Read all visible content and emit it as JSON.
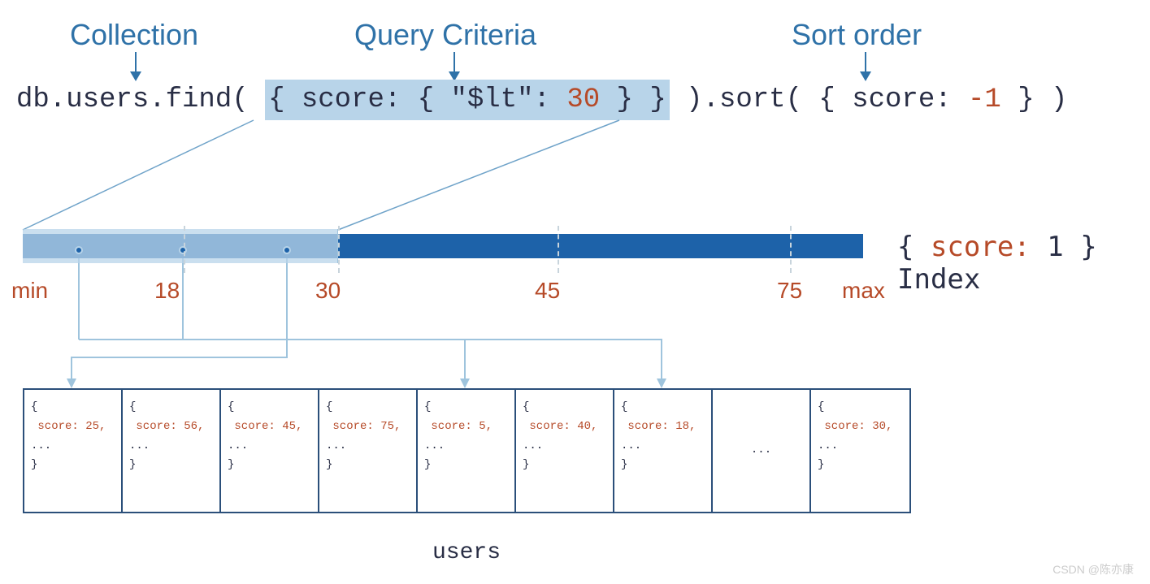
{
  "headings": {
    "collection": "Collection",
    "query": "Query Criteria",
    "sort": "Sort order"
  },
  "code": {
    "p1": "db.users.find( ",
    "hl_open": "{ score: { \"$lt\": ",
    "hl_num": "30",
    "hl_close": " } }",
    "p2": " ).sort( { score: ",
    "sort_num": "-1",
    "p3": " } )"
  },
  "index_label": {
    "open": "{ ",
    "key": "score:",
    "val": " 1",
    "close": " }",
    "word": " Index"
  },
  "axis": {
    "min": "min",
    "v18": "18",
    "v30": "30",
    "v45": "45",
    "v75": "75",
    "max": "max"
  },
  "docs": [
    {
      "kv": " score: 25,"
    },
    {
      "kv": " score: 56,"
    },
    {
      "kv": " score: 45,"
    },
    {
      "kv": " score: 75,"
    },
    {
      "kv": " score: 5,"
    },
    {
      "kv": " score: 40,"
    },
    {
      "kv": " score: 18,"
    },
    {
      "dots": "..."
    },
    {
      "kv": " score: 30,"
    }
  ],
  "collection_label": "users",
  "watermark": "CSDN @陈亦康",
  "chart_data": {
    "type": "table",
    "title": "MongoDB single-field index scan diagram",
    "query_highlight_range": {
      "field": "score",
      "op": "$lt",
      "value": 30
    },
    "index_spec": {
      "score": 1
    },
    "axis_ticks": [
      "min",
      18,
      30,
      45,
      75,
      "max"
    ],
    "selected_range_fraction": 0.375,
    "documents": [
      {
        "score": 25
      },
      {
        "score": 56
      },
      {
        "score": 45
      },
      {
        "score": 75
      },
      {
        "score": 5
      },
      {
        "score": 40
      },
      {
        "score": 18
      },
      "…",
      {
        "score": 30
      }
    ],
    "collection": "users"
  }
}
